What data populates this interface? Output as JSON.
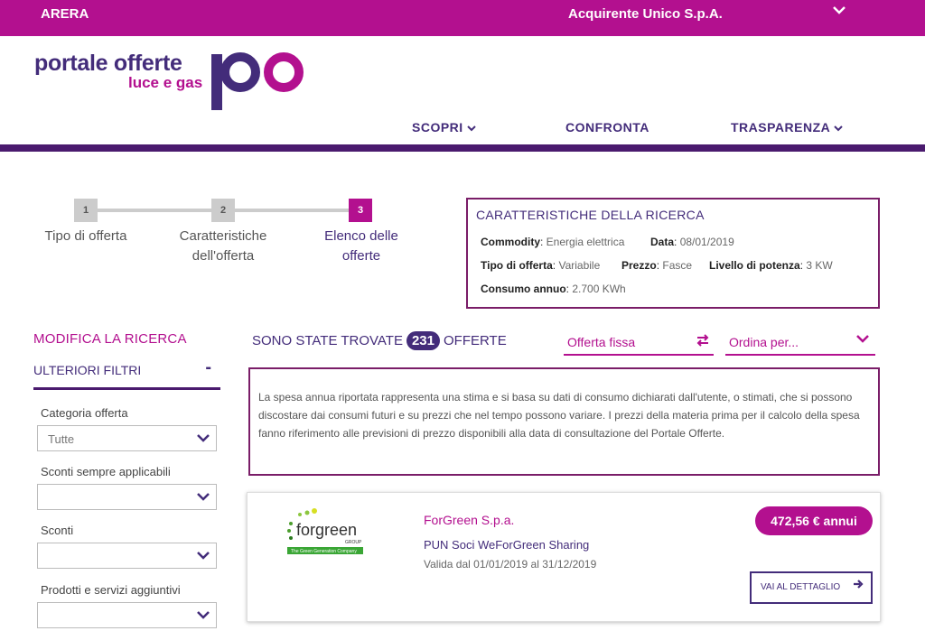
{
  "topbar": {
    "left": "ARERA",
    "center": "Acquirente Unico S.p.A."
  },
  "logo": {
    "line1": "portale offerte",
    "line2": "luce e gas"
  },
  "nav": {
    "scopri": "SCOPRI",
    "confronta": "CONFRONTA",
    "trasparenza": "TRASPARENZA"
  },
  "steps": [
    {
      "num": "1",
      "label1": "Tipo di offerta",
      "label2": ""
    },
    {
      "num": "2",
      "label1": "Caratteristiche",
      "label2": "dell'offerta"
    },
    {
      "num": "3",
      "label1": "Elenco delle",
      "label2": "offerte"
    }
  ],
  "characteristics": {
    "title": "CARATTERISTICHE DELLA RICERCA",
    "commodity_label": "Commodity",
    "commodity": "Energia elettrica",
    "data_label": "Data",
    "data": "08/01/2019",
    "tipo_label": "Tipo di offerta",
    "tipo": "Variabile",
    "prezzo_label": "Prezzo",
    "prezzo": "Fasce",
    "potenza_label": "Livello di potenza",
    "potenza": "3 KW",
    "consumo_label": "Consumo annuo",
    "consumo": "2.700 KWh"
  },
  "sidebar": {
    "title": "MODIFICA LA RICERCA",
    "filters_title": "ULTERIORI FILTRI",
    "filters_toggle": "-",
    "filters": [
      {
        "label": "Categoria offerta",
        "value": "Tutte"
      },
      {
        "label": "Sconti sempre applicabili",
        "value": ""
      },
      {
        "label": "Sconti",
        "value": ""
      },
      {
        "label": "Prodotti e servizi aggiuntivi",
        "value": ""
      }
    ]
  },
  "results": {
    "prefix": "SONO STATE TROVATE",
    "count": "231",
    "suffix": "OFFERTE",
    "filter_dropdown": "Offerta fissa",
    "sort_dropdown": "Ordina per..."
  },
  "info_text": "La spesa annua riportata rappresenta una stima e si basa su dati di consumo dichiarati dall'utente, o stimati, che si possono discostare dai consumi futuri e su prezzi che nel tempo possono variare. I prezzi della materia prima per il calcolo della spesa fanno riferimento alle previsioni di prezzo disponibili alla data di consultazione del Portale Offerte.",
  "offer_card": {
    "logo_text": "forgreen",
    "logo_sub": "GROUP",
    "logo_tagline": "The Green Generation Company",
    "company": "ForGreen S.p.a.",
    "offer_name": "PUN Soci WeForGreen Sharing",
    "validity": "Valida dal 01/01/2019 al 31/12/2019",
    "price": "472,56 € annui",
    "detail_button": "VAI AL DETTAGLIO"
  },
  "colors": {
    "magenta": "#b3108f",
    "purple": "#432c7a",
    "dark_purple": "#4a1a6e"
  }
}
